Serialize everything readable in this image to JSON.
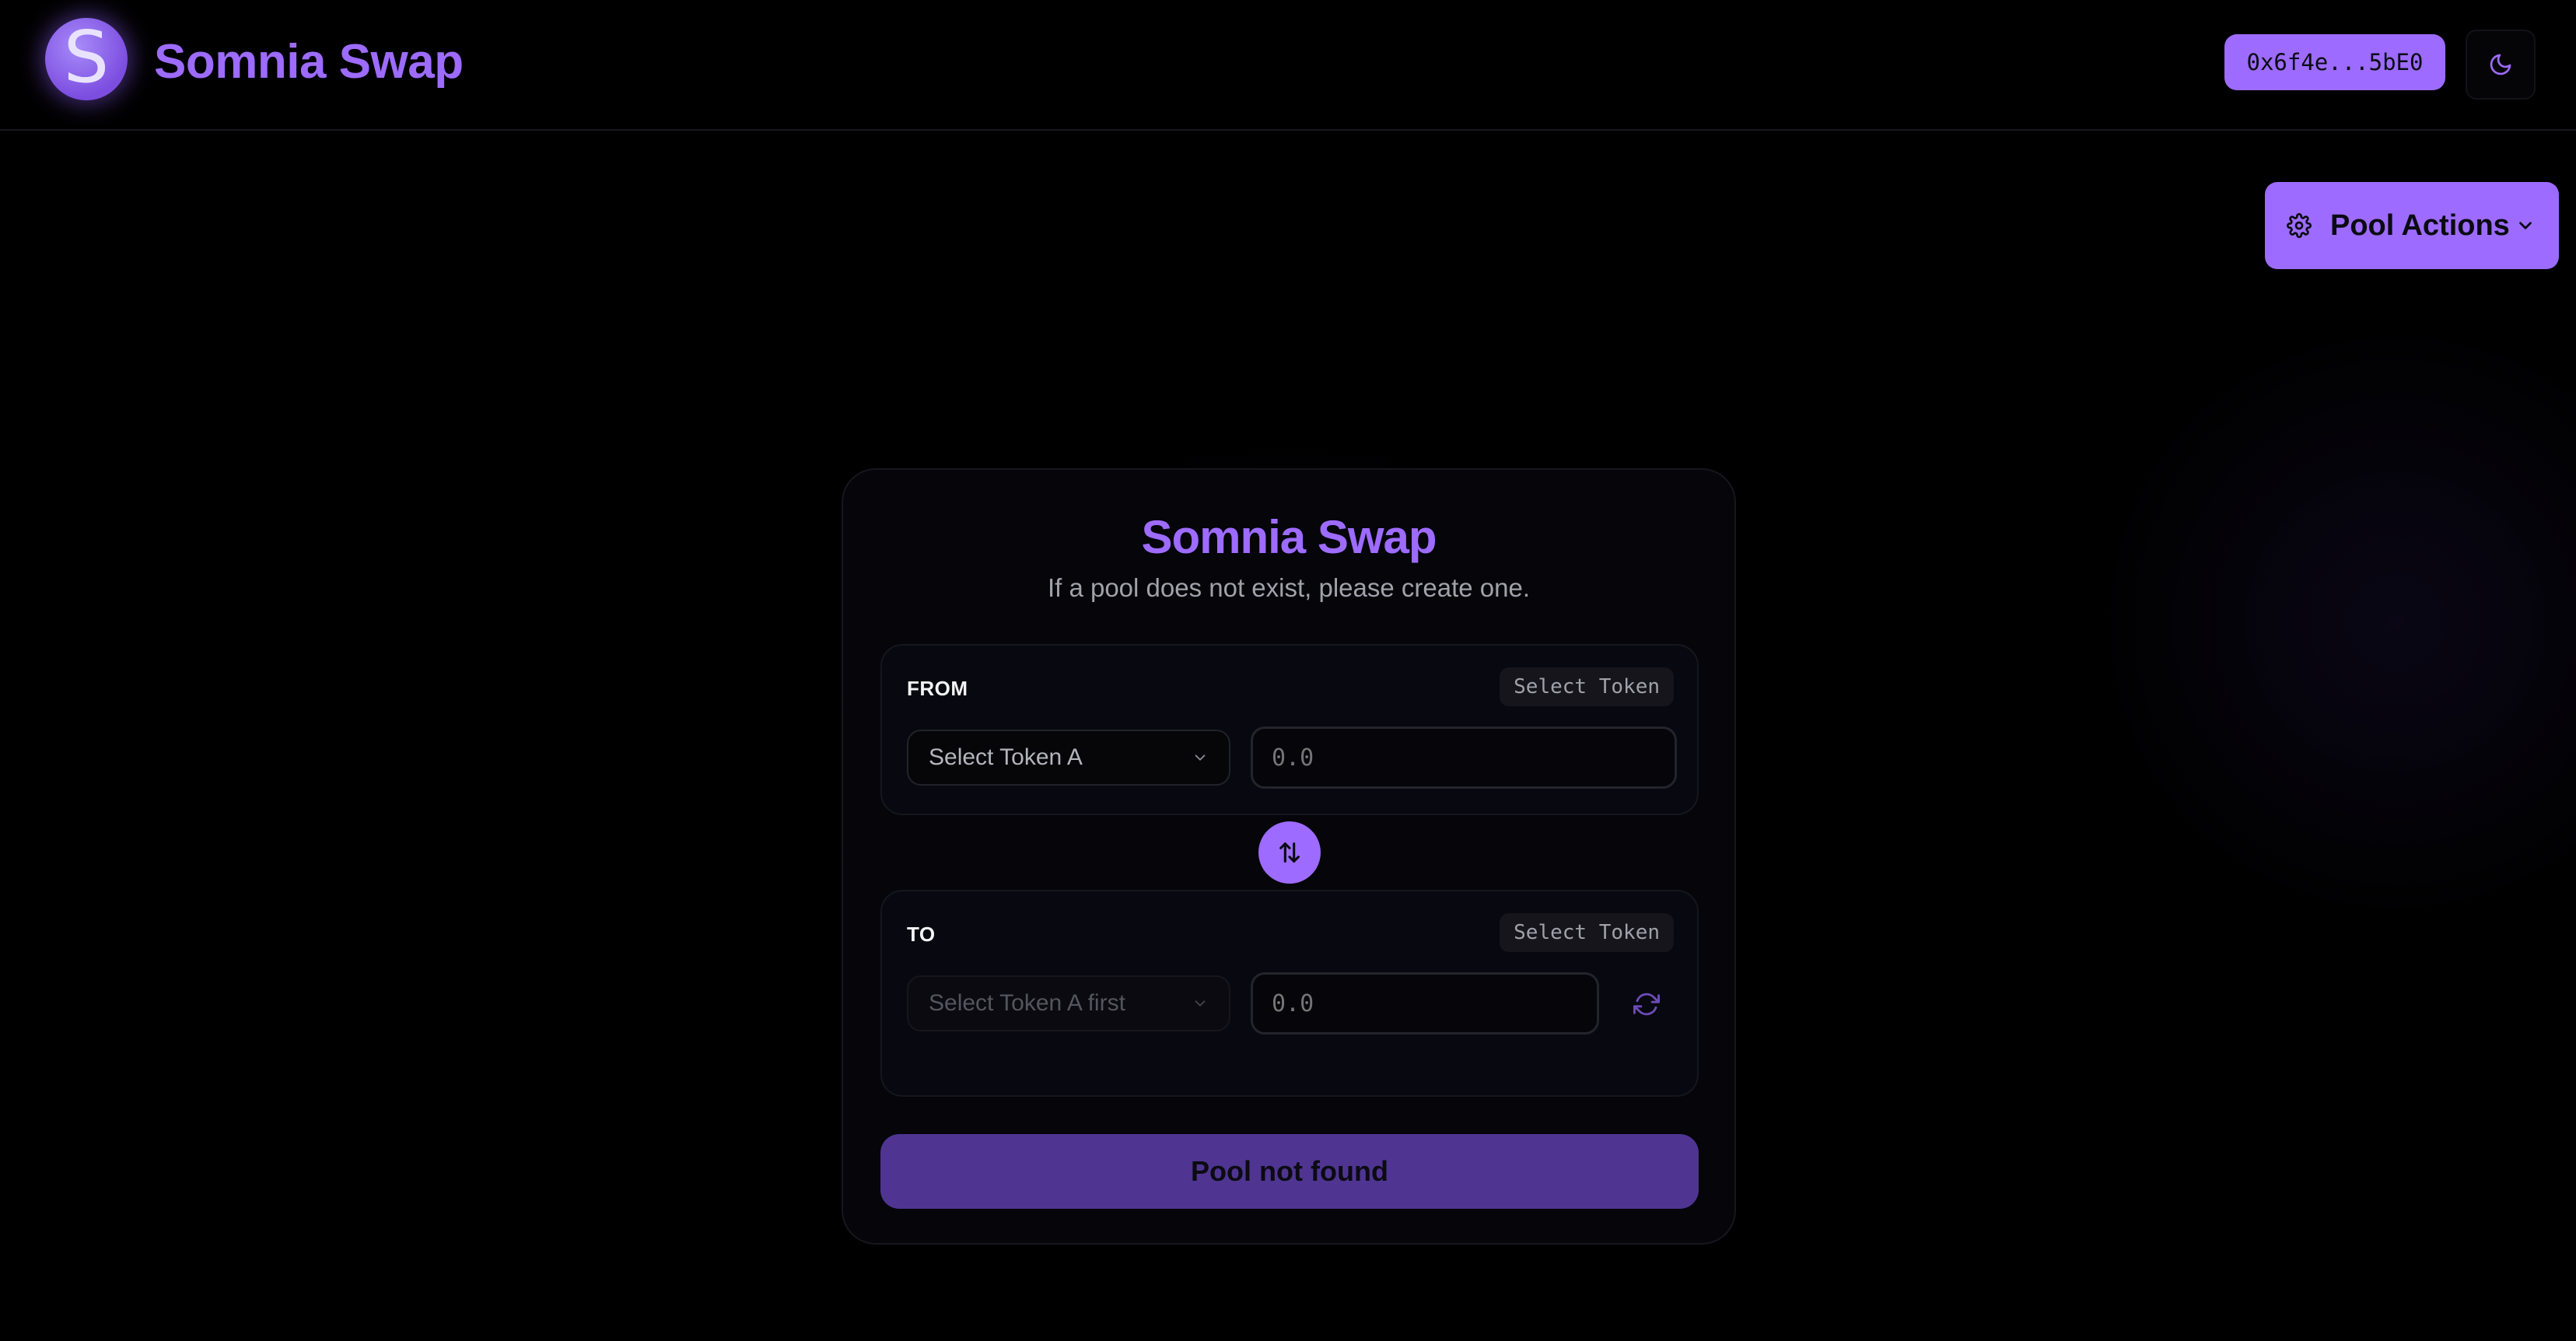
{
  "header": {
    "logo_letter": "S",
    "brand": "Somnia Swap",
    "wallet_address": "0x6f4e...5bE0",
    "theme_icon": "moon-icon"
  },
  "pool_actions": {
    "label": "Pool Actions",
    "icon": "gear-icon",
    "chevron_icon": "chevron-down-icon"
  },
  "swap": {
    "title": "Somnia Swap",
    "subtitle": "If a pool does not exist, please create one.",
    "from": {
      "label": "FROM",
      "chip": "Select Token",
      "select_value": "Select Token A",
      "amount_placeholder": "0.0"
    },
    "to": {
      "label": "TO",
      "chip": "Select Token",
      "select_value": "Select Token A first",
      "amount_placeholder": "0.0"
    },
    "swap_direction_icon": "swap-vertical-icon",
    "refresh_icon": "refresh-icon",
    "submit_label": "Pool not found"
  },
  "colors": {
    "accent": "#9d6bff",
    "accent_muted": "#4f3591",
    "background": "#000000",
    "card": "#05050a"
  }
}
